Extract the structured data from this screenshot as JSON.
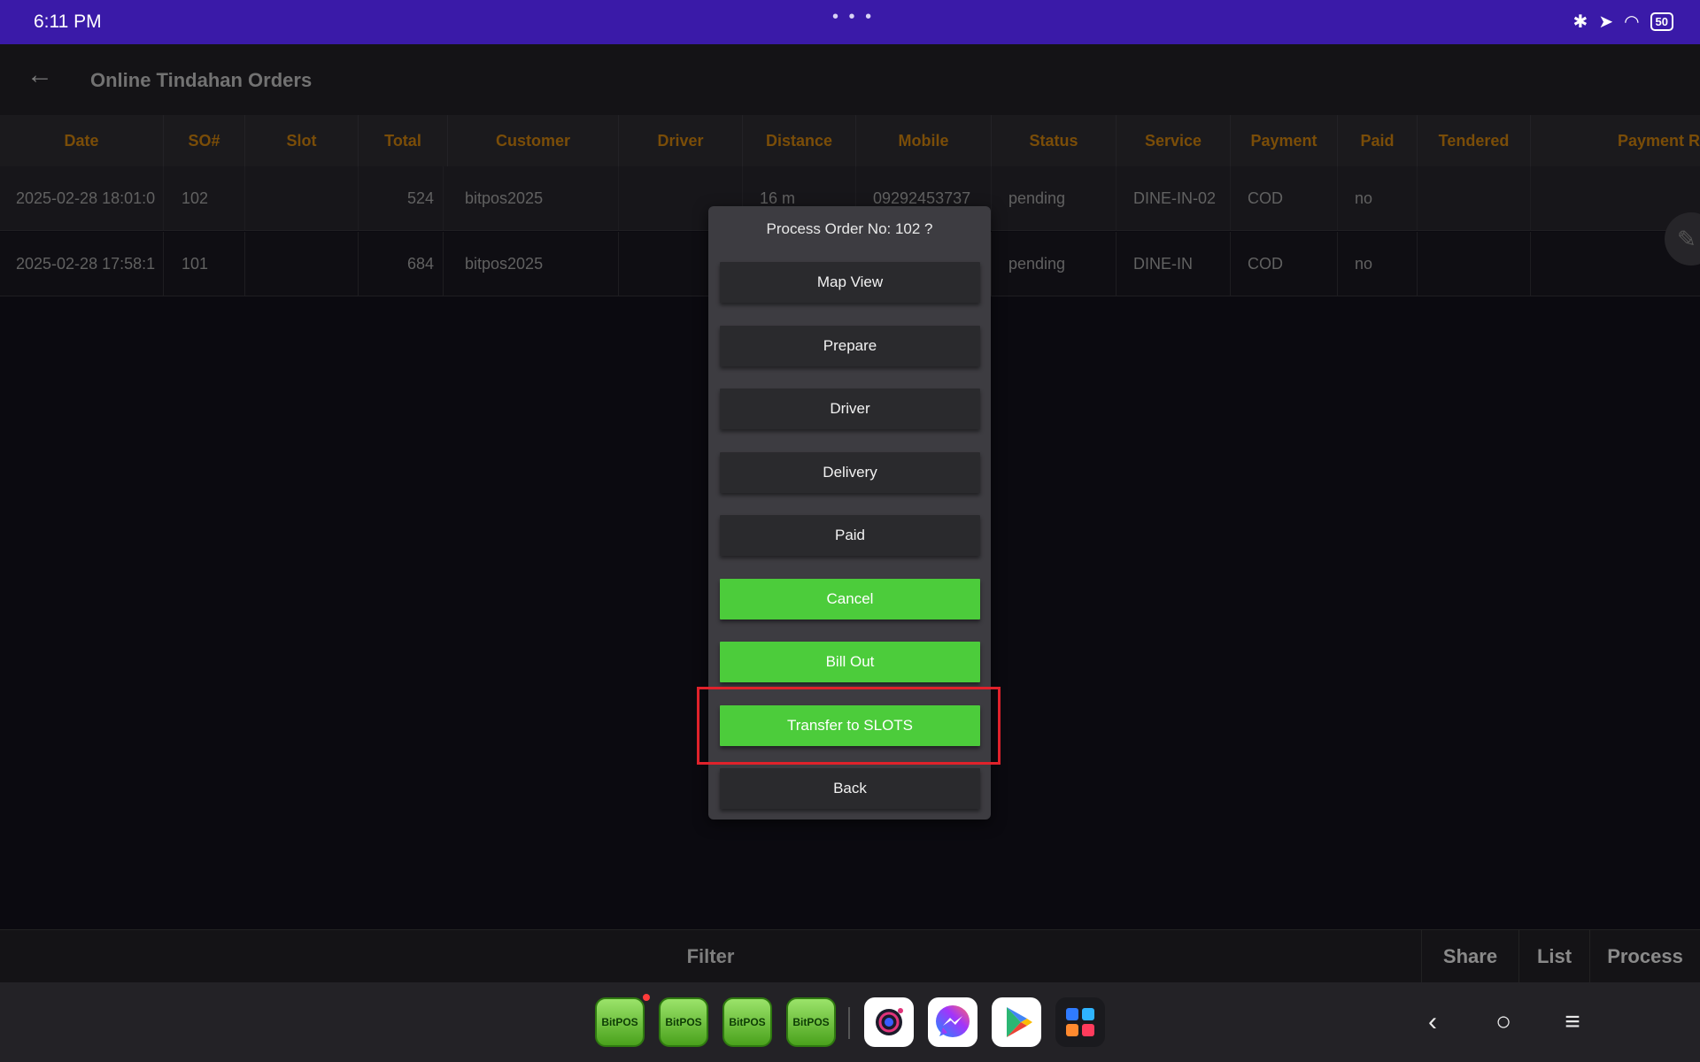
{
  "status_bar": {
    "time": "6:11 PM",
    "dots": "• • •",
    "battery": "50"
  },
  "header": {
    "title": "Online Tindahan Orders"
  },
  "table": {
    "columns": [
      "Date",
      "SO#",
      "Slot",
      "Total",
      "Customer",
      "Driver",
      "Distance",
      "Mobile",
      "Status",
      "Service",
      "Payment",
      "Paid",
      "Tendered",
      "Payment R"
    ],
    "rows": [
      {
        "date": "2025-02-28 18:01:0",
        "so": "102",
        "slot": "",
        "total": "524",
        "customer": "bitpos2025",
        "driver": "",
        "distance": "16 m",
        "mobile": "09292453737",
        "status": "pending",
        "service": "DINE-IN-02",
        "payment": "COD",
        "paid": "no",
        "tendered": ""
      },
      {
        "date": "2025-02-28 17:58:1",
        "so": "101",
        "slot": "",
        "total": "684",
        "customer": "bitpos2025",
        "driver": "",
        "distance": "",
        "mobile": "",
        "status": "pending",
        "service": "DINE-IN",
        "payment": "COD",
        "paid": "no",
        "tendered": ""
      }
    ]
  },
  "dialog": {
    "title": "Process Order No: 102 ?",
    "buttons": [
      "Map View",
      "Prepare",
      "Driver",
      "Delivery",
      "Paid",
      "Cancel",
      "Bill Out",
      "Transfer to SLOTS",
      "Back"
    ]
  },
  "action_bar": {
    "filter": "Filter",
    "share": "Share",
    "list": "List",
    "process": "Process"
  },
  "taskbar": {
    "apps": [
      "BitPOS",
      "BitPOS",
      "BitPOS",
      "BitPOS",
      "camera",
      "messenger",
      "play-store",
      "app-drawer"
    ],
    "bitpos_label": "BitPOS"
  },
  "colors": {
    "accent_green": "#4ccc3b",
    "status_bar": "#3a1aa8",
    "highlight": "#e0222b",
    "header_text": "#7a4d08"
  }
}
